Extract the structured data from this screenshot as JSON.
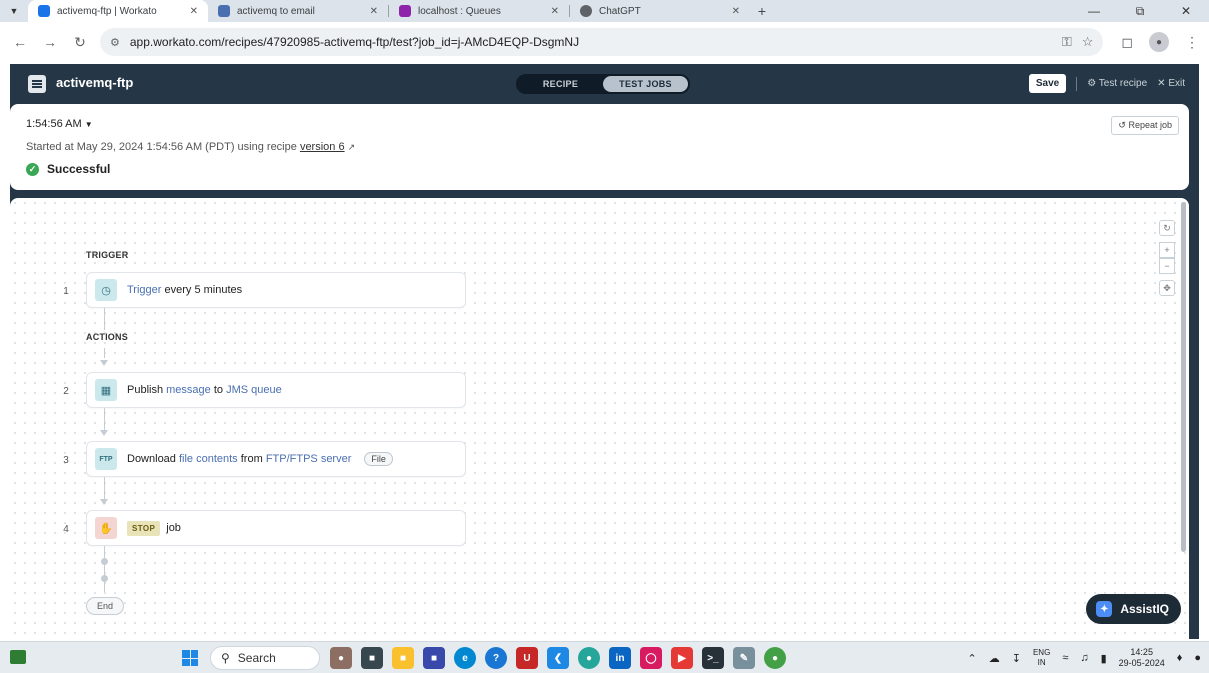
{
  "browser": {
    "tabs": [
      {
        "title": "activemq-ftp | Workato",
        "color": "#1a73e8"
      },
      {
        "title": "activemq to email",
        "color": "#4a6fb0"
      },
      {
        "title": "localhost : Queues",
        "color": "#8e24aa"
      },
      {
        "title": "ChatGPT",
        "color": "#5f6368"
      }
    ],
    "url": "app.workato.com/recipes/47920985-activemq-ftp/test?job_id=j-AMcD4EQP-DsgmNJ"
  },
  "app": {
    "title": "activemq-ftp",
    "mode_tabs": {
      "recipe": "RECIPE",
      "test_jobs": "TEST JOBS"
    },
    "save": "Save",
    "test_recipe": "Test recipe",
    "exit": "Exit"
  },
  "job": {
    "time": "1:54:56 AM",
    "started_prefix": "Started at May 29, 2024 1:54:56 AM (PDT) using recipe",
    "version": "version 6",
    "status": "Successful",
    "repeat": "Repeat job"
  },
  "recipe": {
    "trigger_label": "TRIGGER",
    "actions_label": "ACTIONS",
    "end_label": "End",
    "steps": [
      {
        "num": "1",
        "a": "Trigger",
        "b": "every 5 minutes"
      },
      {
        "num": "2",
        "a": "Publish",
        "b": "message",
        "c": "to",
        "d": "JMS queue"
      },
      {
        "num": "3",
        "a": "Download",
        "b": "file contents",
        "c": "from",
        "d": "FTP/FTPS server",
        "pill": "File"
      },
      {
        "num": "4",
        "badge": "STOP",
        "a": "job"
      }
    ]
  },
  "assist": "AssistIQ",
  "taskbar": {
    "search": "Search",
    "lang_top": "ENG",
    "lang_bottom": "IN",
    "time": "14:25",
    "date": "29-05-2024"
  }
}
